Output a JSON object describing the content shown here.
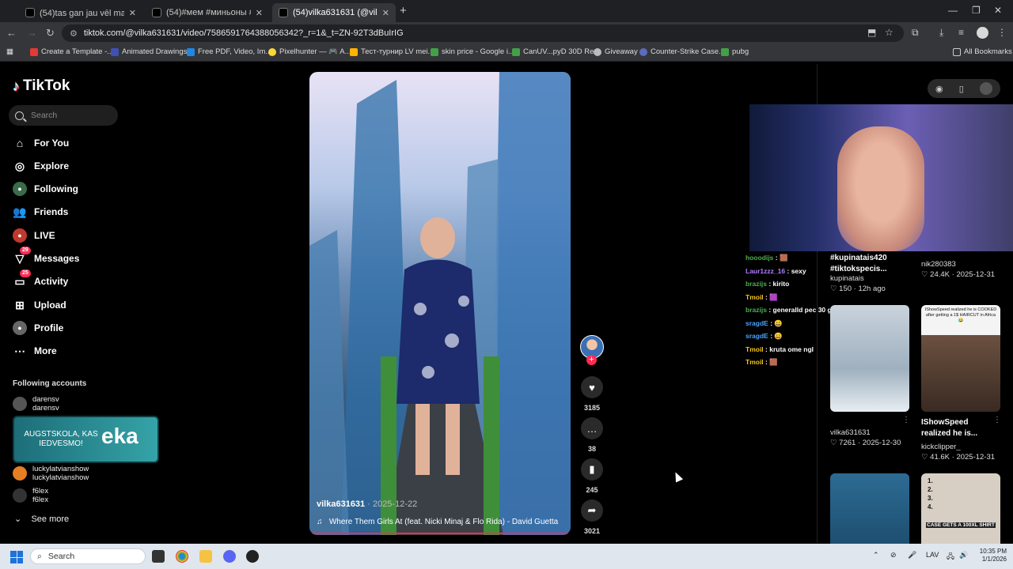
{
  "browser": {
    "tabs": [
      {
        "title": "(54)tas gan jau vēl mainīsies 😡",
        "active": false
      },
      {
        "title": "(54)#мем #миньоны #миньон",
        "active": false
      },
      {
        "title": "(54)vilka631631 (@vilka631",
        "active": true
      }
    ],
    "url": "tiktok.com/@vilka631631/video/7586591764388056342?_r=1&_t=ZN-92T3dBuIrIG",
    "bookmarks": [
      "Create a Template -...",
      "Animated Drawings",
      "Free PDF, Video, Im...",
      "Pixelhunter — 🎮 A...",
      "Тест-турнир LV mei...",
      "skin price - Google i...",
      "CanUV...pyD 30D Re...",
      "Giveaway",
      "Counter-Strike Case...",
      "pubg"
    ],
    "all_bookmarks": "All Bookmarks"
  },
  "tiktok": {
    "logo": "TikTok",
    "search_placeholder": "Search",
    "nav": [
      {
        "label": "For You",
        "icon": "home-icon"
      },
      {
        "label": "Explore",
        "icon": "compass-icon"
      },
      {
        "label": "Following",
        "icon": "following-icon"
      },
      {
        "label": "Friends",
        "icon": "friends-icon"
      },
      {
        "label": "LIVE",
        "icon": "live-icon"
      },
      {
        "label": "Messages",
        "icon": "messages-icon",
        "badge": "29"
      },
      {
        "label": "Activity",
        "icon": "activity-icon",
        "badge": "25"
      },
      {
        "label": "Upload",
        "icon": "upload-icon"
      },
      {
        "label": "Profile",
        "icon": "profile-icon"
      },
      {
        "label": "More",
        "icon": "more-icon"
      }
    ],
    "following_title": "Following accounts",
    "following": [
      {
        "name": "darensv",
        "handle": "darensv"
      },
      {
        "name": "luckylatvianshow",
        "handle": "luckylatvianshow"
      },
      {
        "name": "f6lex",
        "handle": "f6lex"
      }
    ],
    "promo": {
      "text": "AUGSTSKOLA, KAS IEDVESMO!",
      "brand": "eka"
    },
    "see_more": "See more",
    "video": {
      "user": "vilka631631",
      "date": "· 2025-12-22",
      "song": "Where Them Girls At (feat. Nicki Minaj & Flo Rida) - David Guetta",
      "likes": "3185",
      "comments": "38",
      "saves": "245",
      "shares": "3021"
    }
  },
  "chat": [
    {
      "user": "hooodijs",
      "sep": ":",
      "msg": "🟫",
      "color": "#4caf50"
    },
    {
      "user": "Laur1zzz_16",
      "sep": ":",
      "msg": "sexy",
      "color": "#b07cff"
    },
    {
      "user": "brazijs",
      "sep": ":",
      "msg": "kirito",
      "color": "#4caf50"
    },
    {
      "user": "Tmoil",
      "sep": ":",
      "msg": "🟪",
      "color": "#f5c518"
    },
    {
      "user": "brazijs",
      "sep": ":",
      "msg": "generalld pec 30 gadiem",
      "color": "#4caf50"
    },
    {
      "user": "sragdE",
      "sep": ":",
      "msg": "😀",
      "color": "#4aa3ff"
    },
    {
      "user": "sragdE",
      "sep": ":",
      "msg": "😀",
      "color": "#4aa3ff"
    },
    {
      "user": "Tmoil",
      "sep": ":",
      "msg": "kruta ome ngl",
      "color": "#f5c518"
    },
    {
      "user": "Tmoil",
      "sep": ":",
      "msg": "🟫",
      "color": "#f5c518"
    }
  ],
  "related": {
    "top_left": {
      "title": "#kupinatais420 #tiktokspecis...",
      "author": "kupinatais",
      "likes": "150",
      "date": "12h ago"
    },
    "top_right": {
      "author": "nik280383",
      "likes": "24.4K",
      "date": "2025-12-31"
    },
    "mid_left": {
      "author": "vilka631631",
      "likes": "7261",
      "date": "2025-12-30"
    },
    "mid_right": {
      "title": "IShowSpeed realized he is...",
      "author": "kickclipper_",
      "likes": "41.6K",
      "date": "2025-12-31",
      "thumb_text": "IShowSpeed realized he is COOKED after getting a 1$ HAIRCUT in Africa 😂"
    },
    "bottom_right": {
      "thumb_text": "CASE GETS A 100XL SHIRT"
    }
  },
  "taskbar": {
    "search": "Search",
    "lang": "LAV",
    "time": "10:35 PM",
    "date": "1/1/2026"
  }
}
